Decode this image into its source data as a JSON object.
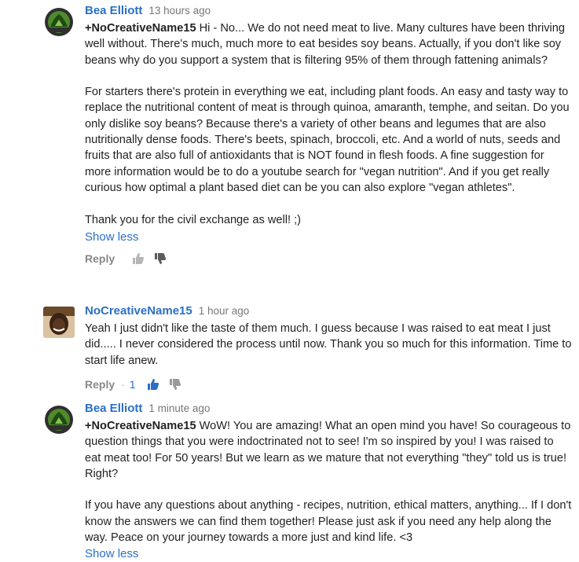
{
  "comments": [
    {
      "author": "Bea Elliott",
      "time": "13 hours ago",
      "mention": "+NoCreativeName15",
      "first_line": " Hi - No... We do not need meat to live. Many cultures have been",
      "paragraph1_rest": "thriving well without. There's much, much more to eat besides soy beans. Actually, if you don't like soy beans why do you support a system that is filtering 95% of them through fattening animals?",
      "paragraph2": "For starters there's protein in everything we eat, including plant foods.  An easy and tasty way to replace the nutritional content of meat is through quinoa, amaranth, temphe, and seitan. Do you only dislike soy beans? Because there's a variety of other beans and legumes that are also nutritionally dense foods. There's beets, spinach, broccoli, etc. And a world of nuts, seeds and fruits that are also full of antioxidants that is NOT found in flesh foods. A fine suggestion for more information would be to do a youtube search for \"vegan nutrition\". And if you get really curious how optimal a plant based diet can be you can also explore \"vegan athletes\".",
      "paragraph3": "Thank you for the civil exchange as well! ;)",
      "show_less": "Show less",
      "reply": "Reply",
      "avatar_color": "#3d6b26"
    },
    {
      "author": "NoCreativeName15",
      "time": "1 hour ago",
      "text": "Yeah I just didn't like the taste of them much. I guess because I was raised to eat meat I just did..... I never considered the process until now. Thank you so much for this information. Time to start life anew.",
      "reply": "Reply",
      "dot": "·",
      "likes": "1"
    },
    {
      "author": "Bea Elliott",
      "time": "1 minute ago",
      "mention": "+NoCreativeName15",
      "first_line": " WoW! You are amazing! What an open mind you have! So",
      "paragraph1_rest": "courageous to question things that you were indoctrinated not to see! I'm so inspired by you! I was raised to eat meat too! For 50 years! But we learn as we mature that not everything \"they\" told us is true! Right?",
      "paragraph2": "If you have any questions about anything - recipes, nutrition, ethical matters, anything... If I don't know the answers we can find them together! Please just ask if you need any help along the way. Peace on your journey towards a more just and kind life. <3",
      "show_less": "Show less"
    }
  ],
  "colors": {
    "link": "#2a6fc5",
    "muted": "#888888",
    "text": "#222222"
  }
}
